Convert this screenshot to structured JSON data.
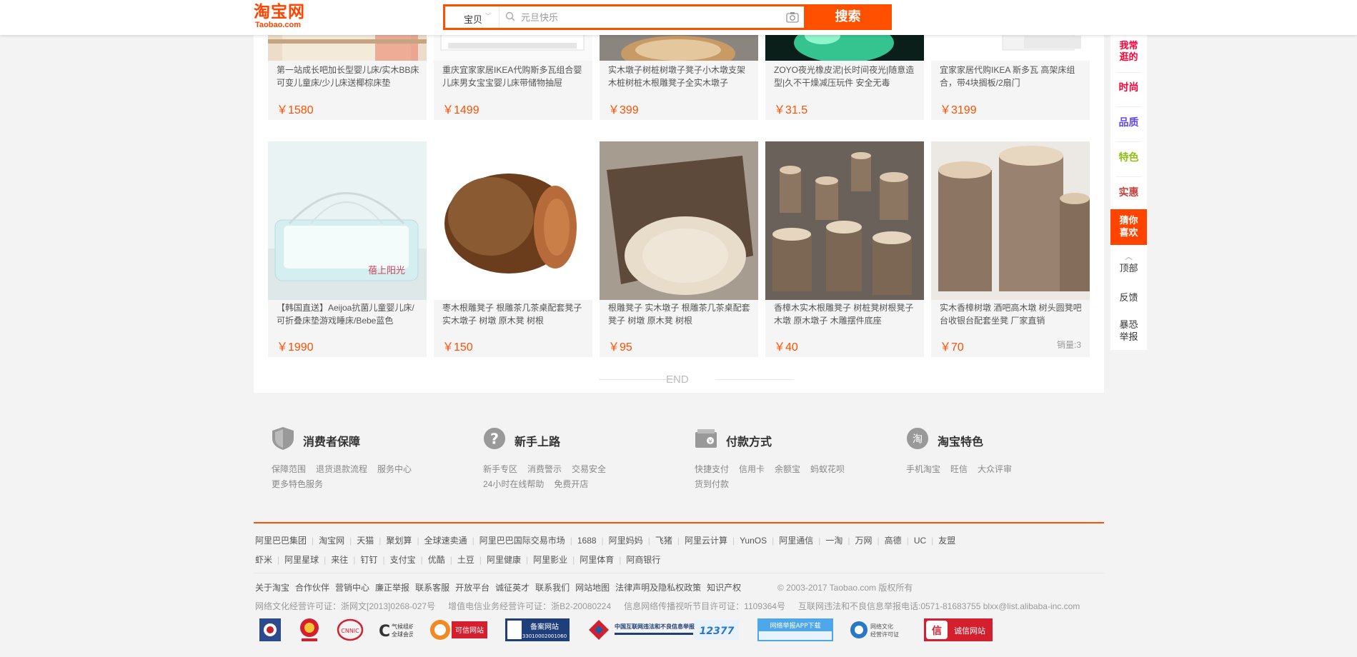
{
  "topbar": {
    "logo_cn": "淘宝网",
    "logo_en": "Taobao.com",
    "scope": "宝贝",
    "search_placeholder": "元旦快乐",
    "search_button": "搜索"
  },
  "products_row1": [
    {
      "title": "第一站成长吧加长型婴儿床/实木BB床可变儿童床/少儿床送椰棕床垫",
      "price": "￥1580"
    },
    {
      "title": "重庆宜家家居IKEA代购斯多瓦组合婴儿床男女宝宝婴儿床带储物抽屉",
      "price": "￥1499"
    },
    {
      "title": "实木墩子树桩树墩子凳子小木墩支架木桩树桩木根雕凳子全实木墩子",
      "price": "￥399"
    },
    {
      "title": "ZOYO夜光橡皮泥|长时间夜光|随意造型|久不干燥减压玩件 安全无毒",
      "price": "￥31.5"
    },
    {
      "title": "宜家家居代购IKEA 斯多瓦 高架床组合，带4块搁板/2扇门",
      "price": "￥3199"
    }
  ],
  "products_row2": [
    {
      "title": "【韩国直送】Aeijoa抗菌儿童婴儿床/可折叠床垫游戏睡床/Bebe蓝色",
      "price": "￥1990",
      "sales": ""
    },
    {
      "title": "枣木根雕凳子 根雕茶几茶桌配套凳子实木墩子 树墩 原木凳 树根",
      "price": "￥150",
      "sales": ""
    },
    {
      "title": "根雕凳子 实木墩子 根雕茶几茶桌配套凳子 树墩 原木凳 树根",
      "price": "￥95",
      "sales": ""
    },
    {
      "title": "香樟木实木根雕凳子 树桩凳树根凳子木墩 原木墩子 木雕摆件底座",
      "price": "￥40",
      "sales": ""
    },
    {
      "title": "实木香樟树墩 酒吧高木墩 树头圆凳吧台收银台配套坐凳 厂家直销",
      "price": "￥70",
      "sales": "销量:3"
    }
  ],
  "end_text": "END",
  "right_nav": {
    "items": [
      {
        "label": "我常逛的",
        "color": "#ff0036"
      },
      {
        "label": "时尚",
        "color": "#ff0036"
      },
      {
        "label": "品质",
        "color": "#6347ed"
      },
      {
        "label": "特色",
        "color": "#8fbe14"
      },
      {
        "label": "实惠",
        "color": "#c4413a"
      }
    ],
    "active": "猜你喜欢",
    "top": "顶部",
    "feedback": "反馈",
    "report": "暴恐举报"
  },
  "services": [
    {
      "title": "消费者保障",
      "links": [
        "保障范围",
        "退货退款流程",
        "服务中心",
        "更多特色服务"
      ]
    },
    {
      "title": "新手上路",
      "links": [
        "新手专区",
        "消费警示",
        "交易安全",
        "24小时在线帮助",
        "免费开店"
      ]
    },
    {
      "title": "付款方式",
      "links": [
        "快捷支付",
        "信用卡",
        "余额宝",
        "蚂蚁花呗",
        "货到付款"
      ]
    },
    {
      "title": "淘宝特色",
      "links": [
        "手机淘宝",
        "旺信",
        "大众评审"
      ]
    }
  ],
  "footer": {
    "group_links_1": [
      "阿里巴巴集团",
      "淘宝网",
      "天猫",
      "聚划算",
      "全球速卖通",
      "阿里巴巴国际交易市场",
      "1688",
      "阿里妈妈",
      "飞猪",
      "阿里云计算",
      "YunOS",
      "阿里通信",
      "一淘",
      "万网",
      "高德",
      "UC",
      "友盟"
    ],
    "group_links_2": [
      "虾米",
      "阿里星球",
      "来往",
      "钉钉",
      "支付宝",
      "优酷",
      "土豆",
      "阿里健康",
      "阿里影业",
      "阿里体育",
      "阿商银行"
    ],
    "about_links": [
      "关于淘宝",
      "合作伙伴",
      "营销中心",
      "廉正举报",
      "联系客服",
      "开放平台",
      "诚征英才",
      "联系我们",
      "网站地图",
      "法律声明及隐私权政策",
      "知识产权"
    ],
    "copyright": "© 2003-2017 Taobao.com 版权所有",
    "licenses": [
      "网络文化经营许可证：浙网文[2013]0268-027号",
      "增值电信业务经营许可证：浙B2-20080224",
      "信息网络传播视听节目许可证：1109364号",
      "互联网违法和不良信息举报电话:0571-81683755 blxx@list.alibaba-inc.com"
    ],
    "badges": [
      "可信网站",
      "备案网站",
      "中国互联网违法和不良信息举报中心",
      "12377",
      "网络举报APP下载",
      "网络文化经营许可证",
      "诚信网站"
    ]
  }
}
